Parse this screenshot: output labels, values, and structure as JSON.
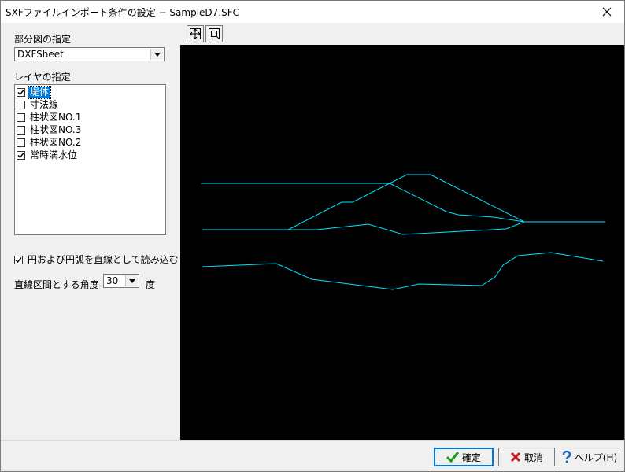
{
  "window": {
    "title": "SXFファイルインポート条件の設定 − SampleD7.SFC",
    "close_glyph": "✕"
  },
  "partial_view": {
    "label": "部分図の指定",
    "selected": "DXFSheet"
  },
  "layers": {
    "label": "レイヤの指定",
    "items": [
      {
        "label": "堤体",
        "checked": true,
        "selected": true
      },
      {
        "label": "寸法線",
        "checked": false,
        "selected": false
      },
      {
        "label": "柱状図NO.1",
        "checked": false,
        "selected": false
      },
      {
        "label": "柱状図NO.3",
        "checked": false,
        "selected": false
      },
      {
        "label": "柱状図NO.2",
        "checked": false,
        "selected": false
      },
      {
        "label": "常時満水位",
        "checked": true,
        "selected": false
      }
    ]
  },
  "arc_option": {
    "label": "円および円弧を直線として読み込む",
    "checked": true
  },
  "angle": {
    "label": "直線区間とする角度",
    "value": "30",
    "unit": "度"
  },
  "toolbar": {
    "fit_icon": "zoom-fit-icon",
    "window_icon": "zoom-window-icon"
  },
  "colors": {
    "canvas_bg": "#000000",
    "line": "#00e5ff",
    "selection": "#0078d7"
  },
  "buttons": {
    "ok_label": "確定",
    "cancel_label": "取消",
    "help_label": "ヘルプ(H)"
  }
}
